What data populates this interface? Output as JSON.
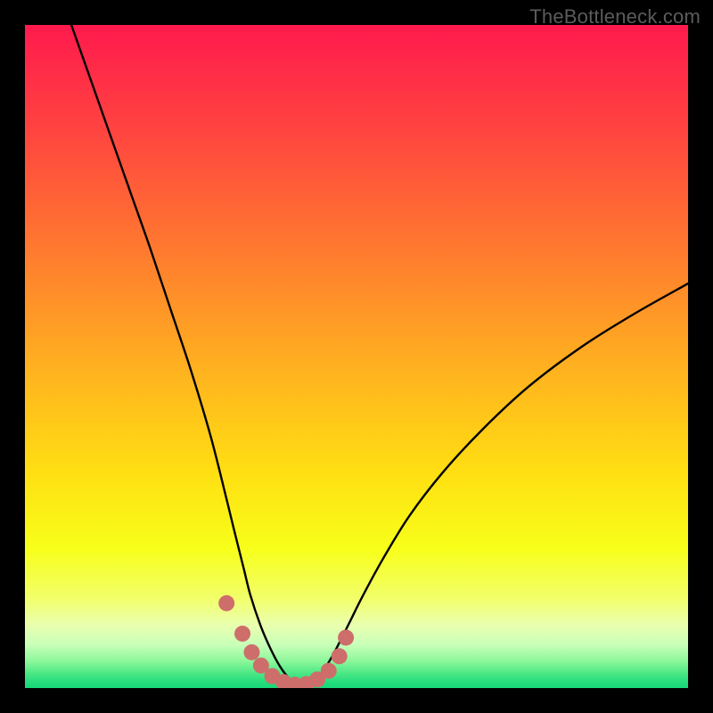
{
  "watermark": "TheBottleneck.com",
  "chart_data": {
    "type": "line",
    "title": "",
    "xlabel": "",
    "ylabel": "",
    "x_range": [
      0,
      100
    ],
    "y_range": [
      0,
      100
    ],
    "note": "Axes are implicit (no tick labels shown). Values are estimated percentages of the plot area. The curve depicts a bottleneck-style V shape reaching ~0 near x≈41.",
    "series": [
      {
        "name": "bottleneck-curve",
        "color": "#000000",
        "x": [
          7,
          10,
          13,
          16,
          19,
          22,
          25,
          28,
          30.4,
          31.5,
          33,
          34,
          35.5,
          37,
          38.5,
          40,
          41.5,
          43,
          44.5,
          46,
          47.5,
          49,
          51,
          54,
          58,
          63,
          69,
          76,
          84,
          92,
          100
        ],
        "y": [
          100,
          91.5,
          83,
          74.5,
          66,
          57,
          48,
          38,
          28.5,
          24,
          18,
          14,
          9.5,
          6,
          3.2,
          1.3,
          0.4,
          0.7,
          2.0,
          4.2,
          7.0,
          10.0,
          14.0,
          19.5,
          26.0,
          32.5,
          39.0,
          45.5,
          51.5,
          56.5,
          61.0
        ]
      }
    ],
    "markers": {
      "name": "highlight-points",
      "color": "#cd6e6b",
      "approx_radius_px": 9,
      "points": [
        {
          "x": 30.4,
          "y": 12.8
        },
        {
          "x": 32.8,
          "y": 8.2
        },
        {
          "x": 34.2,
          "y": 5.4
        },
        {
          "x": 35.6,
          "y": 3.4
        },
        {
          "x": 37.3,
          "y": 1.8
        },
        {
          "x": 39.0,
          "y": 0.9
        },
        {
          "x": 40.7,
          "y": 0.5
        },
        {
          "x": 42.4,
          "y": 0.6
        },
        {
          "x": 44.1,
          "y": 1.3
        },
        {
          "x": 45.8,
          "y": 2.6
        },
        {
          "x": 47.4,
          "y": 4.8
        },
        {
          "x": 48.4,
          "y": 7.6
        }
      ]
    },
    "background_gradient": {
      "type": "vertical",
      "stops": [
        {
          "offset": 0.0,
          "color": "#ff1a4d"
        },
        {
          "offset": 0.16,
          "color": "#ff4440"
        },
        {
          "offset": 0.34,
          "color": "#ff7a2f"
        },
        {
          "offset": 0.52,
          "color": "#ffb21f"
        },
        {
          "offset": 0.68,
          "color": "#ffe012"
        },
        {
          "offset": 0.79,
          "color": "#f7ff1a"
        },
        {
          "offset": 0.865,
          "color": "#f2ff6a"
        },
        {
          "offset": 0.905,
          "color": "#eaffb0"
        },
        {
          "offset": 0.935,
          "color": "#c8ffb8"
        },
        {
          "offset": 0.96,
          "color": "#8af79a"
        },
        {
          "offset": 0.977,
          "color": "#4fe886"
        },
        {
          "offset": 0.99,
          "color": "#27dd7d"
        },
        {
          "offset": 1.0,
          "color": "#17d877"
        }
      ]
    }
  }
}
